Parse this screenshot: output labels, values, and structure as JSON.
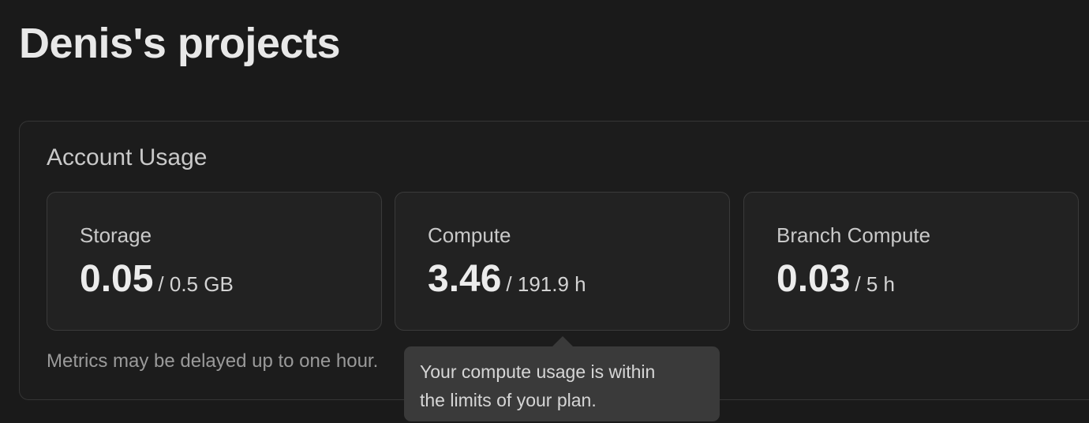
{
  "header": {
    "title": "Denis's projects"
  },
  "usage": {
    "title": "Account Usage",
    "metrics": [
      {
        "label": "Storage",
        "value": "0.05",
        "limit": "/ 0.5 GB"
      },
      {
        "label": "Compute",
        "value": "3.46",
        "limit": "/ 191.9 h"
      },
      {
        "label": "Branch Compute",
        "value": "0.03",
        "limit": "/ 5 h"
      }
    ],
    "footnote": "Metrics may be delayed up to one hour."
  },
  "tooltip": {
    "line1": "Your compute usage is within",
    "line2": "the limits of your plan."
  },
  "colors": {
    "background": "#1a1a1a",
    "card": "#222222",
    "tooltip": "#3a3a3a"
  }
}
